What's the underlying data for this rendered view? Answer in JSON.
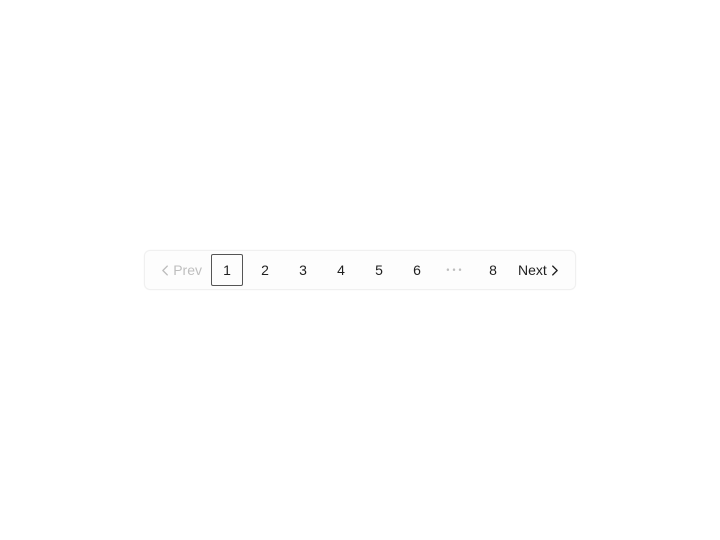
{
  "pagination": {
    "prev_label": "Prev",
    "next_label": "Next",
    "prev_disabled": true,
    "next_disabled": false,
    "current_page": 1,
    "pages_before": [
      "1",
      "2",
      "3",
      "4",
      "5",
      "6"
    ],
    "ellipsis": "•••",
    "pages_after": [
      "8"
    ]
  }
}
